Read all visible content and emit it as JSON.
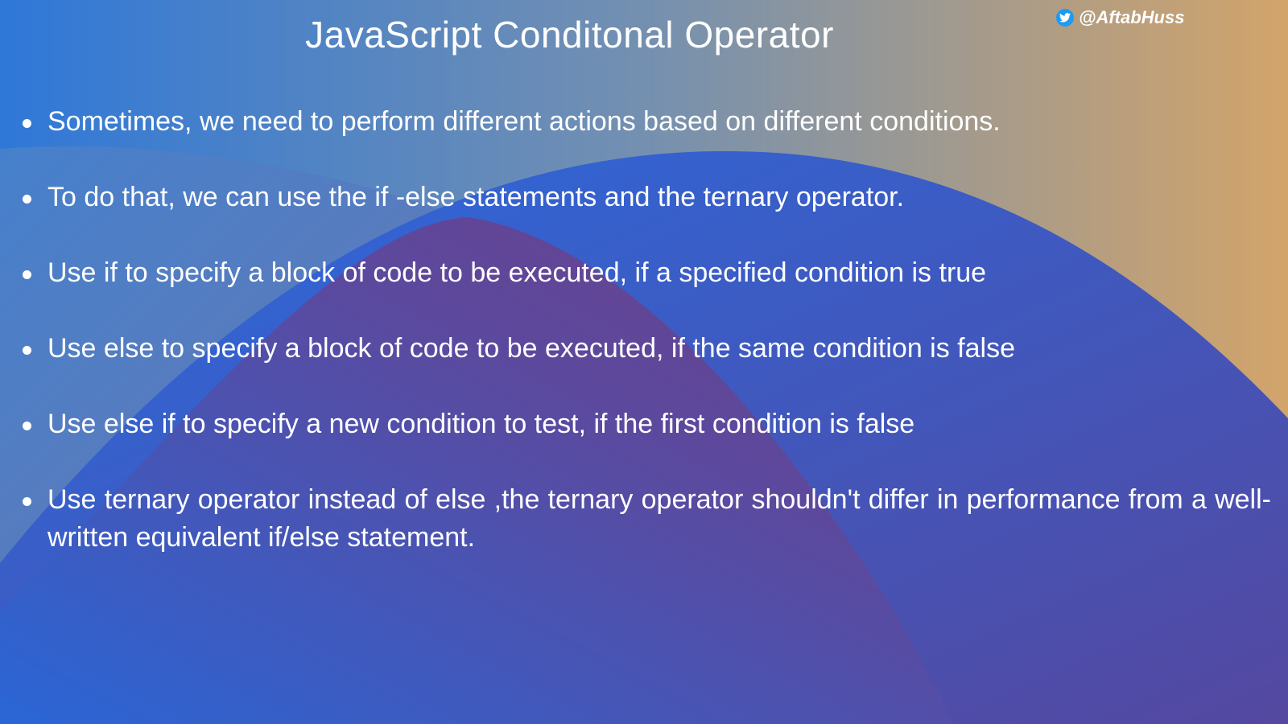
{
  "title": "JavaScript  Conditonal Operator",
  "handle": {
    "icon": "twitter-icon",
    "text": "@AftabHuss",
    "icon_color": "#1d9bf0"
  },
  "bullets": [
    "Sometimes, we need to perform different actions based on different conditions.",
    "To do that, we can use the if -else statements and the ternary operator.",
    "Use if to specify a block of code to be executed, if a specified condition is true",
    "Use else to specify a block of code to be executed, if the same condition is false",
    "Use else if to specify a new condition to test, if the first condition is false",
    "Use ternary operator instead of else ,the ternary operator shouldn't differ in performance from a well-written equivalent if/else statement."
  ],
  "colors": {
    "blue": "#2f78d8",
    "tan": "#d0a46c",
    "purple": "#6a3f8e"
  }
}
